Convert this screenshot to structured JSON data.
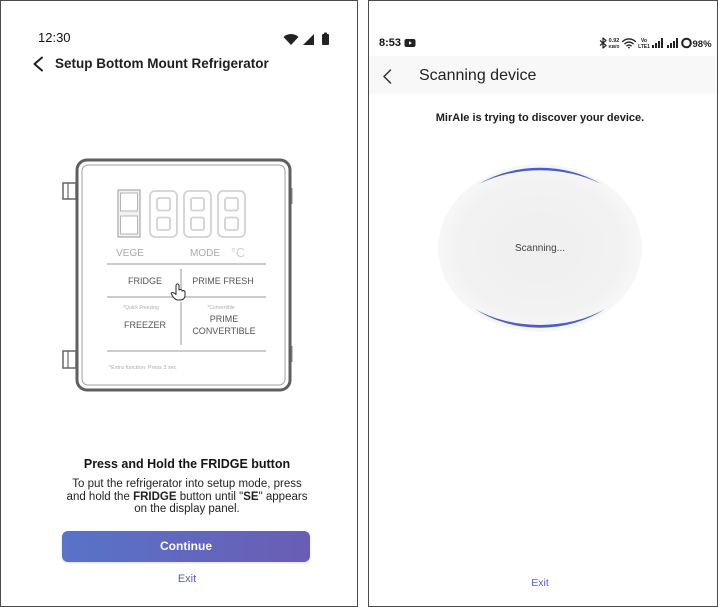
{
  "left": {
    "status": {
      "time": "12:30",
      "icons": [
        "wifi-icon",
        "signal-icon",
        "battery-icon"
      ]
    },
    "header": {
      "title": "Setup Bottom Mount Refrigerator",
      "back_icon": "chevron-left-icon"
    },
    "illustration": {
      "vege": "VEGE",
      "mode": "MODE",
      "unit": "°C",
      "fridge": "FRIDGE",
      "prime_fresh": "PRIME FRESH",
      "quick_freezing": "*Quick Freezing",
      "convertible_note": "*Convertible",
      "freezer": "FREEZER",
      "prime": "PRIME",
      "convertible": "CONVERTIBLE",
      "extra_function": "*Extra function: Press 3 sec",
      "cursor_icon": "hand-pointer-icon"
    },
    "instruction": {
      "title": "Press and Hold the FRIDGE button",
      "line1": "To put the refrigerator into setup mode, press",
      "line2": [
        "and hold the ",
        "FRIDGE",
        " button until \"",
        "SE",
        "\" appears"
      ],
      "line3": "on the display panel."
    },
    "continue_label": "Continue",
    "exit_label": "Exit"
  },
  "right": {
    "status": {
      "time": "8:53",
      "net_speed": "0.92",
      "net_unit": "KB/S",
      "volte_top": "Vo",
      "volte_bottom": "LTE1",
      "battery": "98%",
      "icons": [
        "video-notification-icon",
        "bluetooth-icon",
        "wifi-icon",
        "signal-icon",
        "signal-icon",
        "battery-ring-icon"
      ]
    },
    "header": {
      "title": "Scanning device",
      "back_icon": "chevron-left-icon"
    },
    "message": "MirAIe is trying to discover your device.",
    "spinner_label": "Scanning...",
    "exit_label": "Exit"
  },
  "colors": {
    "button_start": "#5873c8",
    "button_end": "#6a5db4",
    "link": "#5a5dbf",
    "spinner": "#4b5ec8"
  }
}
